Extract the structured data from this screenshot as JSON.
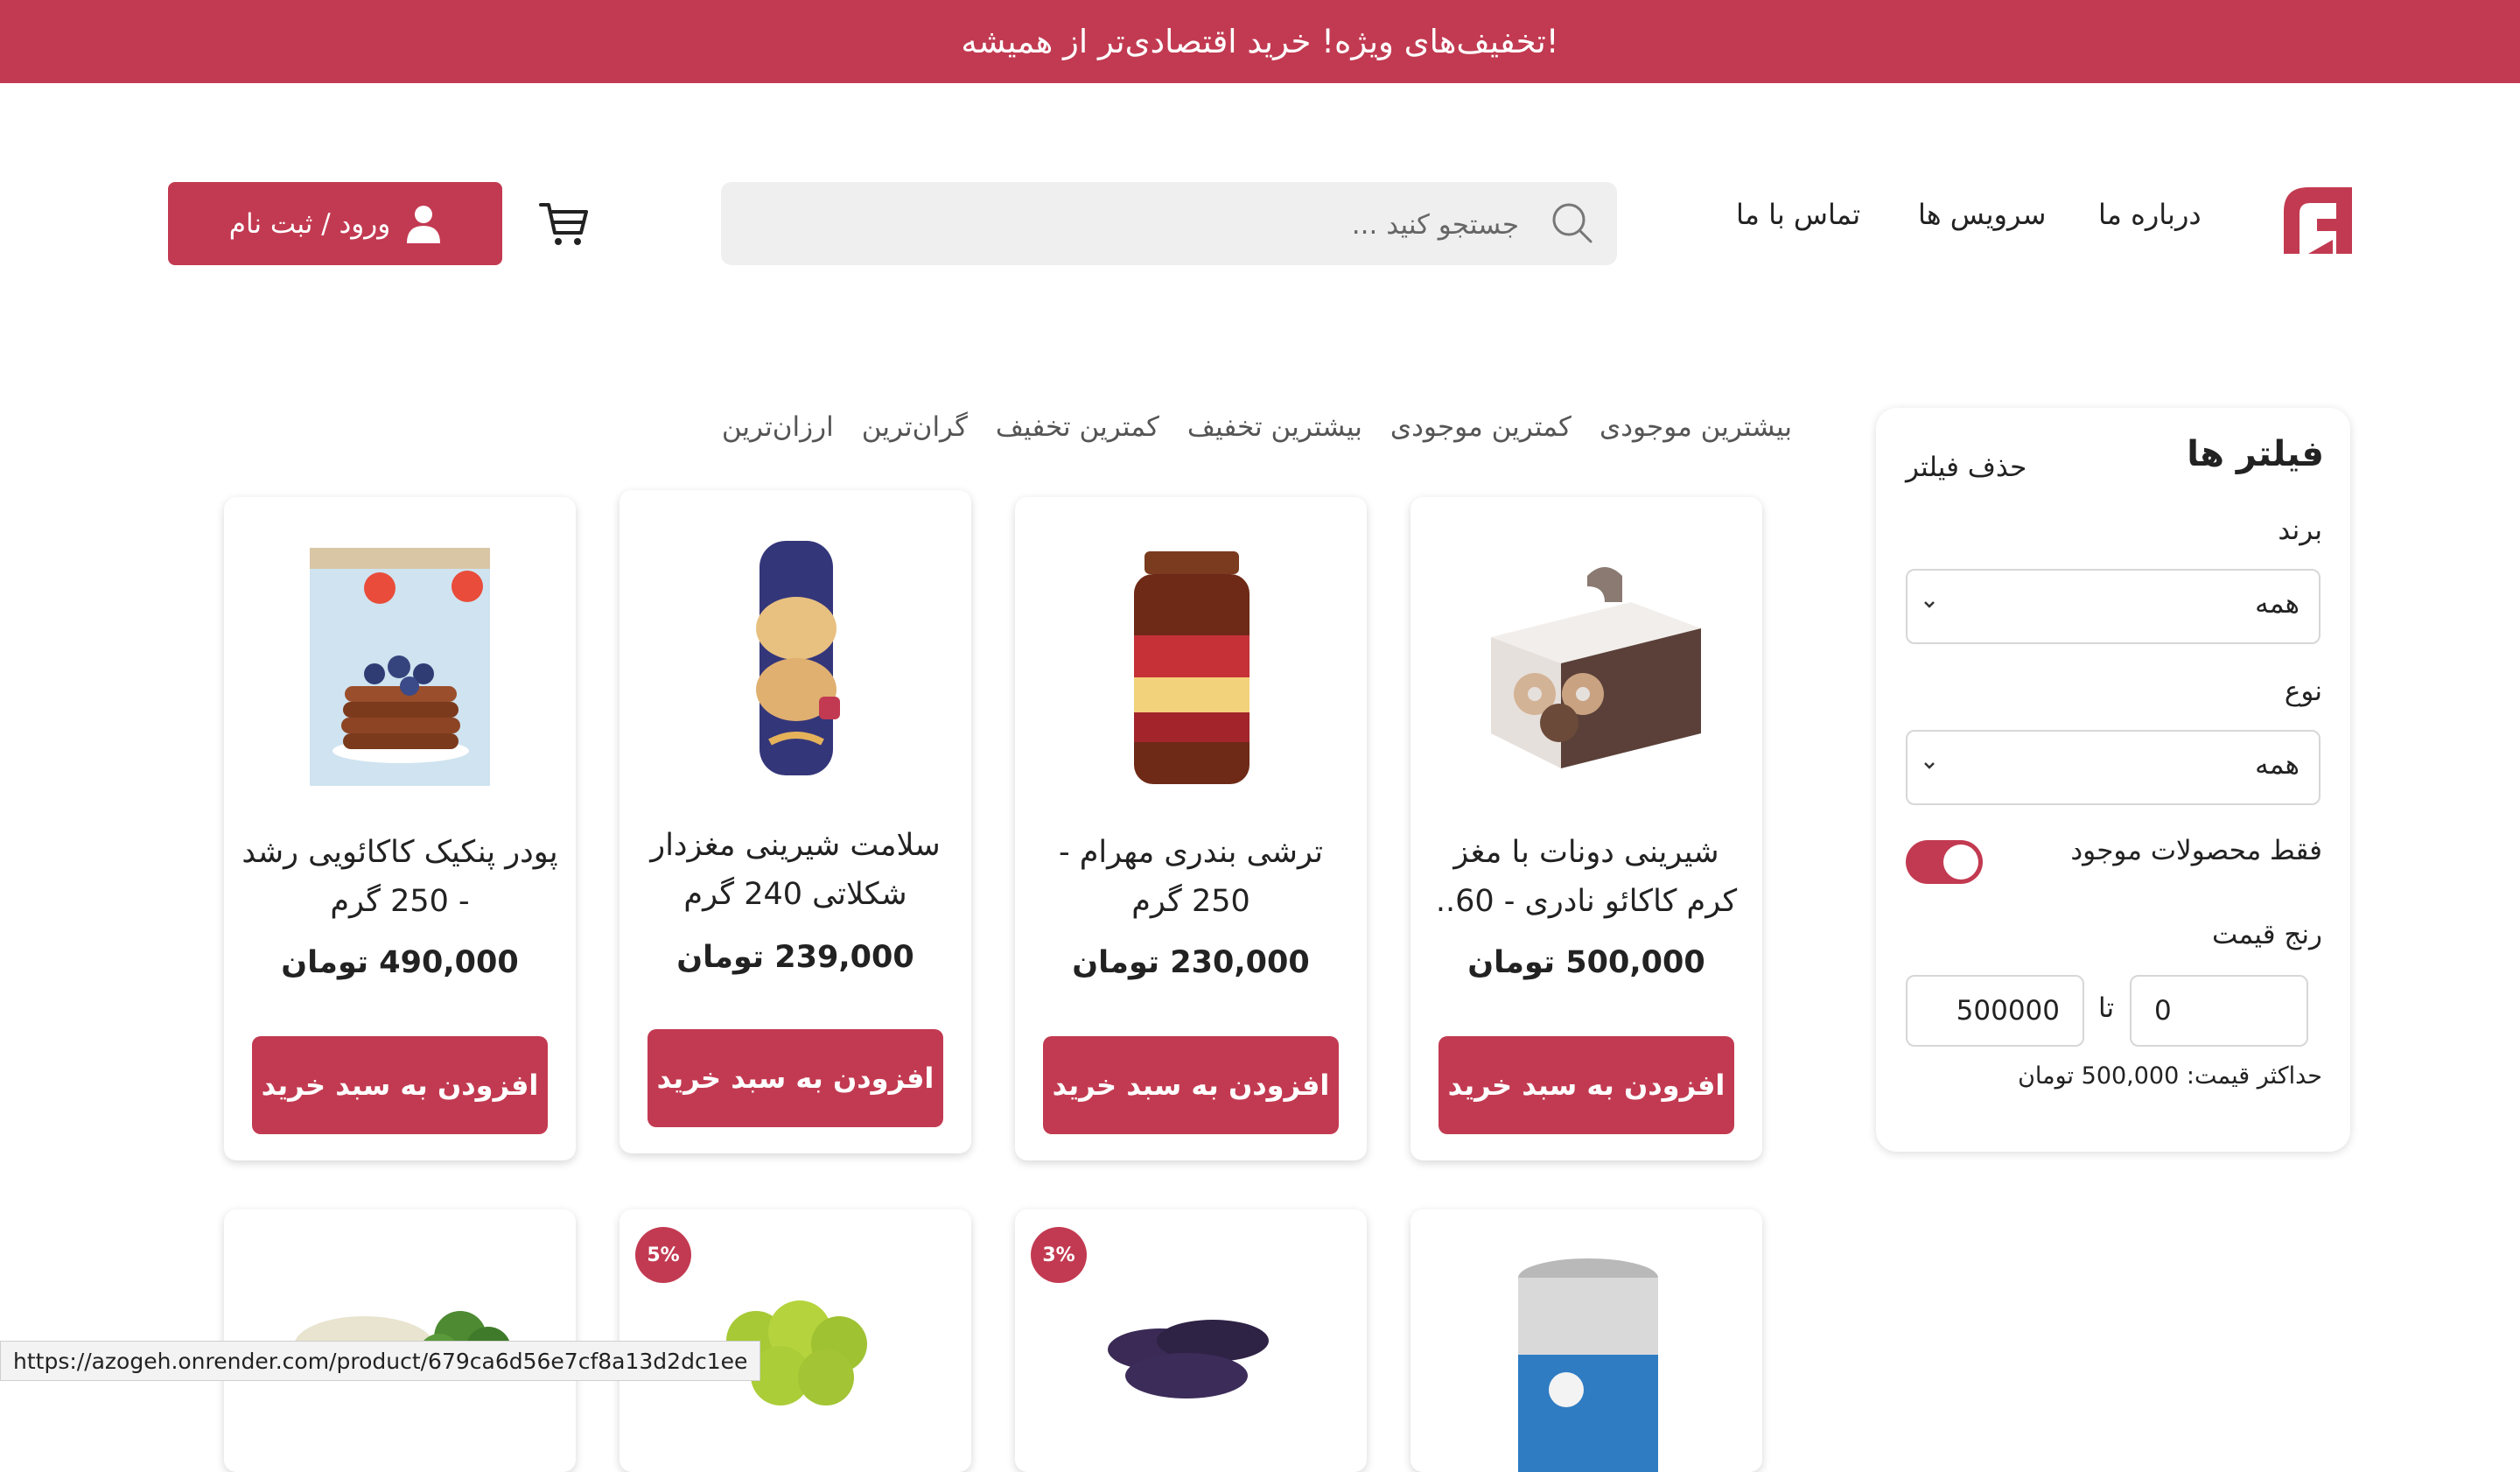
{
  "promo_banner": "تخفیف‌های ویژه! خرید اقتصادی‌تر از همیشه!",
  "header": {
    "nav": [
      "درباره ما",
      "سرویس ها",
      "تماس با ما"
    ],
    "search_placeholder": "جستجو کنید ...",
    "login_label": "ورود / ثبت نام"
  },
  "filters": {
    "title": "فیلتر ها",
    "clear": "حذف فیلتر",
    "brand_label": "برند",
    "brand_value": "همه",
    "type_label": "نوع",
    "type_value": "همه",
    "in_stock_label": "فقط محصولات موجود",
    "in_stock_enabled": true,
    "price_range_label": "رنج قیمت",
    "price_min": "0",
    "price_to": "تا",
    "price_max": "500000",
    "max_price_note": "حداکثر قیمت: 500,000 تومان"
  },
  "sort_options": [
    "بیشترین موجودی",
    "کمترین موجودی",
    "بیشترین تخفیف",
    "کمترین تخفیف",
    "گران‌ترین",
    "ارزان‌ترین"
  ],
  "products": [
    {
      "title": "شیرینی دونات با مغز کرم کاکائو نادری - 60..",
      "price": "500,000 تومان",
      "button": "افزودن به سبد خرید"
    },
    {
      "title": "ترشی بندری مهرام - 250 گرم",
      "price": "230,000 تومان",
      "button": "افزودن به سبد خرید"
    },
    {
      "title": "سلامت شیرینی مغزدار شکلاتی 240 گرم",
      "price": "239,000 تومان",
      "button": "افزودن به سبد خرید"
    },
    {
      "title": "پودر پنکیک کاکائویی رشد - 250 گرم",
      "price": "490,000 تومان",
      "button": "افزودن به سبد خرید"
    }
  ],
  "second_row_badges": [
    "3%",
    "5%"
  ],
  "status_url": "https://azogeh.onrender.com/product/679ca6d56e7cf8a13d2dc1ee",
  "colors": {
    "accent": "#c23a51"
  }
}
